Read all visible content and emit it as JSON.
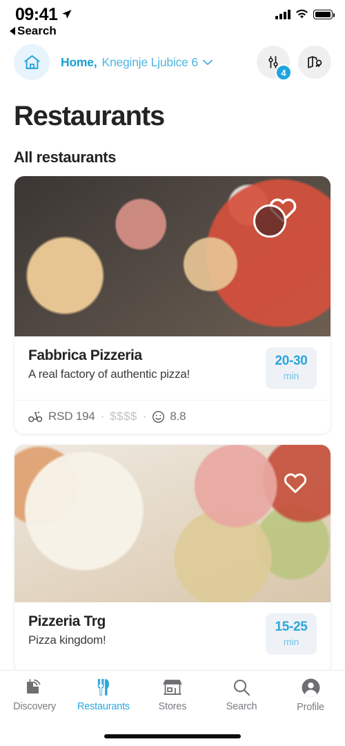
{
  "status_bar": {
    "time": "09:41",
    "back_label": "Search",
    "location_arrow_icon": "location-arrow-icon",
    "signal_icon": "cellular-signal-icon",
    "wifi_icon": "wifi-icon",
    "battery_icon": "battery-full-icon"
  },
  "header": {
    "home_icon": "home-icon",
    "address_label": "Home,",
    "address_street": "Kneginje Ljubice 6",
    "chevron_icon": "chevron-down-icon",
    "filter_icon": "filter-sliders-icon",
    "filter_badge": "4",
    "map_icon": "map-pin-icon"
  },
  "page": {
    "title": "Restaurants",
    "section_title": "All restaurants"
  },
  "restaurants": [
    {
      "name": "Fabbrica Pizzeria",
      "description": "A real factory of authentic pizza!",
      "eta_value": "20-30",
      "eta_unit": "min",
      "delivery_icon": "delivery-bike-icon",
      "delivery_fee": "RSD 194",
      "separator": "·",
      "price_level": "$$$$",
      "rating_icon": "smiley-rating-icon",
      "rating": "8.8",
      "favorite_icon": "heart-outline-icon",
      "has_cursor": true
    },
    {
      "name": "Pizzeria Trg",
      "description": "Pizza kingdom!",
      "eta_value": "15-25",
      "eta_unit": "min",
      "favorite_icon": "heart-outline-icon",
      "has_cursor": false
    }
  ],
  "tabbar": [
    {
      "label": "Discovery",
      "icon": "discovery-building-icon",
      "active": false
    },
    {
      "label": "Restaurants",
      "icon": "fork-knife-icon",
      "active": true
    },
    {
      "label": "Stores",
      "icon": "storefront-icon",
      "active": false
    },
    {
      "label": "Search",
      "icon": "search-icon",
      "active": false
    },
    {
      "label": "Profile",
      "icon": "profile-avatar-icon",
      "active": false
    }
  ],
  "colors": {
    "accent": "#2ba6dd",
    "accent_dark": "#1a9fd4",
    "text": "#232326",
    "muted": "#6e6e73"
  }
}
